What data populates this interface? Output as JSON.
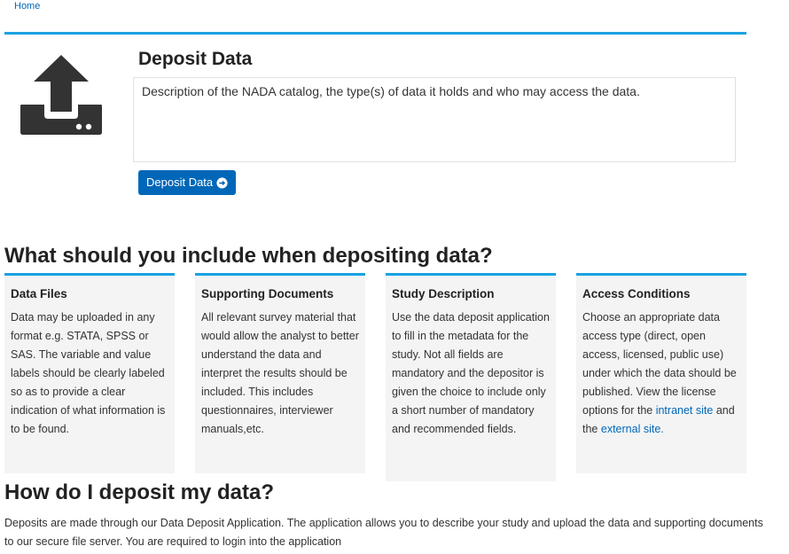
{
  "breadcrumb": {
    "home": "Home"
  },
  "header": {
    "title": "Deposit Data",
    "description": "Description of the NADA catalog, the type(s) of data it holds and who may access the data.",
    "button_label": "Deposit Data",
    "icon": "upload-icon",
    "accent_color": "#1ba1e2",
    "button_color": "#0067b8"
  },
  "include_section": {
    "heading": "What should you include when depositing data?",
    "cards": [
      {
        "title": "Data Files",
        "body": "Data may be uploaded in any format e.g. STATA, SPSS or SAS. The variable and value labels should be clearly labeled so as to provide a clear indication of what information is to be found."
      },
      {
        "title": "Supporting Documents",
        "body": "All relevant survey material that would allow the analyst to better understand the data and interpret the results should be included. This includes questionnaires, interviewer manuals,etc."
      },
      {
        "title": "Study Description",
        "body": "Use the data deposit application to fill in the metadata for the study. Not all fields are mandatory and the depositor is given the choice to include only a short number of mandatory and recommended fields."
      },
      {
        "title": "Access Conditions",
        "body_before": "Choose an appropriate data access type (direct, open access, licensed, public use) under which the data should be published. View the license options for the",
        "link1": "intranet site",
        "body_middle": "and the",
        "link2": "external site.",
        "body_after": ""
      }
    ]
  },
  "how_section": {
    "heading": "How do I deposit my data?",
    "text": "Deposits are made through our Data Deposit Application. The application allows you to describe your study and upload the data and supporting documents to our secure file server. You are required to login into the application"
  }
}
